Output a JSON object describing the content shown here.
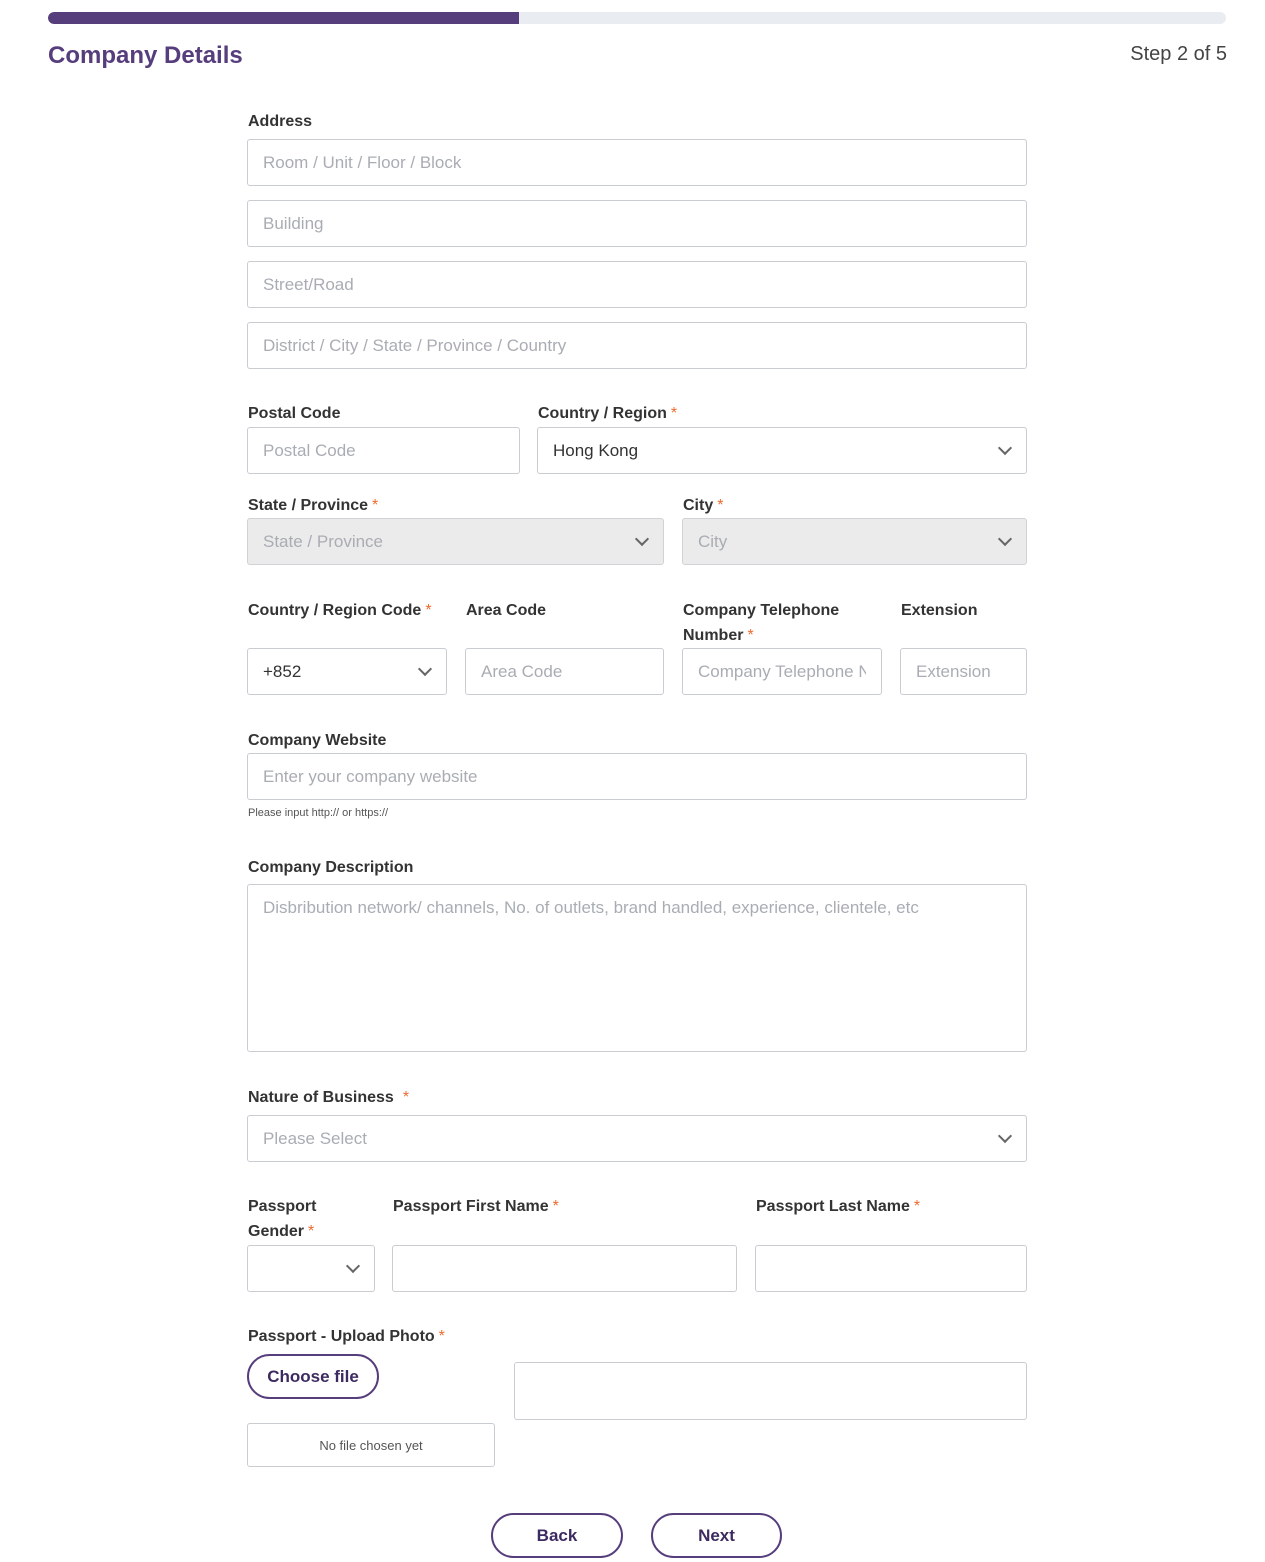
{
  "progress": {
    "percent": 40
  },
  "header": {
    "title": "Company Details",
    "step": "Step 2 of 5"
  },
  "address": {
    "label": "Address",
    "line1_placeholder": "Room / Unit / Floor / Block",
    "line2_placeholder": "Building",
    "line3_placeholder": "Street/Road",
    "line4_placeholder": "District / City / State / Province / Country"
  },
  "postal": {
    "label": "Postal Code",
    "placeholder": "Postal Code"
  },
  "country": {
    "label": "Country / Region",
    "required": "*",
    "value": "Hong Kong"
  },
  "state": {
    "label": "State / Province",
    "required": "*",
    "placeholder": "State / Province"
  },
  "city": {
    "label": "City",
    "required": "*",
    "placeholder": "City"
  },
  "phone": {
    "country_code_label": "Country / Region Code",
    "country_code_required": "*",
    "country_code_value": "+852",
    "area_code_label": "Area Code",
    "area_code_placeholder": "Area Code",
    "number_label_line1": "Company Telephone",
    "number_label_line2": "Number",
    "number_required": "*",
    "number_placeholder": "Company Telephone N",
    "extension_label": "Extension",
    "extension_placeholder": "Extension"
  },
  "website": {
    "label": "Company Website",
    "placeholder": "Enter your company website",
    "hint": "Please input http:// or https://"
  },
  "description": {
    "label": "Company Description",
    "placeholder": "Disbribution network/ channels, No. of outlets, brand handled, experience, clientele, etc"
  },
  "nature": {
    "label": "Nature of Business",
    "required": "*",
    "placeholder": "Please Select"
  },
  "passport": {
    "gender_label_line1": "Passport",
    "gender_label_line2": "Gender",
    "gender_required": "*",
    "gender_value": "",
    "first_name_label": "Passport First Name",
    "first_name_required": "*",
    "last_name_label": "Passport Last Name",
    "last_name_required": "*",
    "upload_label": "Passport - Upload Photo",
    "upload_required": "*",
    "choose_file": "Choose file",
    "no_file": "No file chosen yet"
  },
  "nav": {
    "back": "Back",
    "next": "Next"
  },
  "colors": {
    "accent": "#563d7c",
    "required": "#ef6a2e",
    "disabled_bg": "#ebebeb"
  }
}
